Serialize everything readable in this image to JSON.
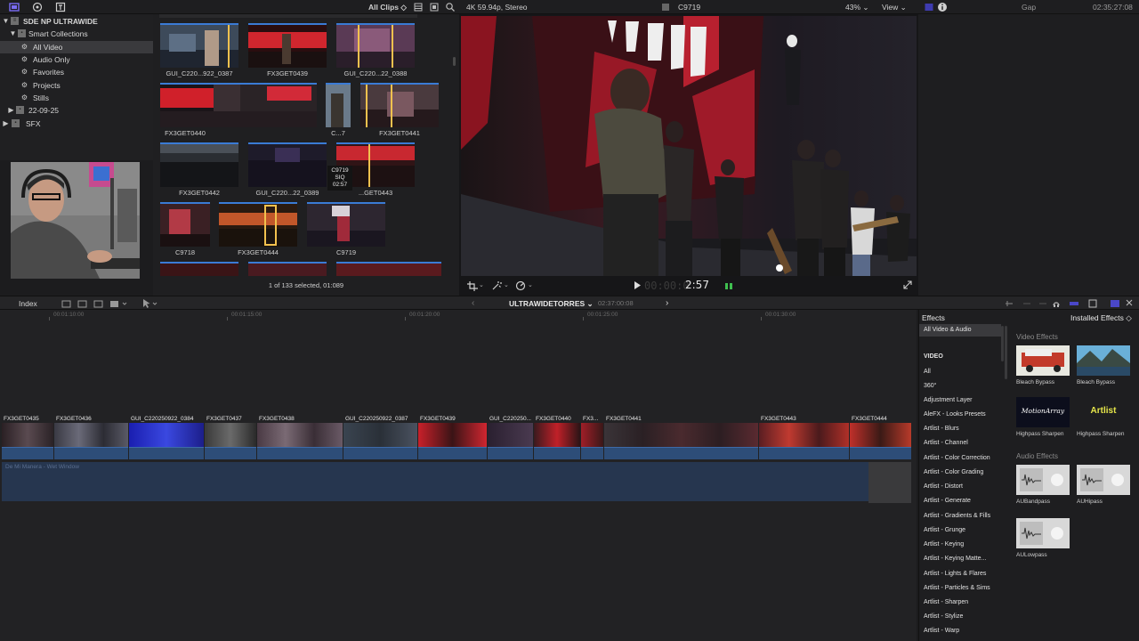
{
  "top_bar": {
    "library_name": "SDE NP ULTRAWIDE",
    "browser_filter": "All Clips",
    "format": "4K 59.94p, Stereo",
    "viewer_clip": "C9719",
    "zoom": "43%",
    "view_menu": "View",
    "gap_label": "Gap",
    "timecode": "02:35:27:08"
  },
  "library": {
    "items": [
      {
        "label": "SDE NP ULTRAWIDE",
        "glyph": "▼"
      },
      {
        "label": "Smart Collections",
        "glyph": "▼"
      },
      {
        "label": "All Video",
        "glyph": "⚙"
      },
      {
        "label": "Audio Only",
        "glyph": "⚙"
      },
      {
        "label": "Favorites",
        "glyph": "⚙"
      },
      {
        "label": "Projects",
        "glyph": "⚙"
      },
      {
        "label": "Stills",
        "glyph": "⚙"
      },
      {
        "label": "22-09-25",
        "glyph": "▶"
      },
      {
        "label": "SFX",
        "glyph": "▶"
      }
    ]
  },
  "browser": {
    "clips": [
      {
        "name": "GUI_C220...922_0387"
      },
      {
        "name": "FX3GET0439"
      },
      {
        "name": "GUI_C220...22_0388"
      },
      {
        "name": "FX3GET0440"
      },
      {
        "name": "C...7"
      },
      {
        "name": "FX3GET0441"
      },
      {
        "name": "FX3GET0442"
      },
      {
        "name": "GUI_C220...22_0389"
      },
      {
        "name": "...GET0443"
      },
      {
        "name": "C9718"
      },
      {
        "name": "FX3GET0444"
      },
      {
        "name": "C9719"
      }
    ],
    "skim_tooltip": {
      "line1": "C9719",
      "line2": "SIQ",
      "line3": "02:57"
    },
    "status": "1 of 133 selected, 01:089"
  },
  "viewer": {
    "timecode": "2:57"
  },
  "timeline_toolbar": {
    "index_label": "Index",
    "project_name": "ULTRAWIDETORRES",
    "project_duration": "02:37:00:08"
  },
  "timeline": {
    "ruler": [
      "00:01:10:00",
      "00:01:15:00",
      "00:01:20:00",
      "00:01:25:00",
      "00:01:30:00"
    ],
    "clips": [
      {
        "name": "FX3GET0435"
      },
      {
        "name": "FX3GET0436"
      },
      {
        "name": "GUI_C220250922_0384"
      },
      {
        "name": "FX3GET0437"
      },
      {
        "name": "FX3GET0438"
      },
      {
        "name": "GUI_C220250922_0387"
      },
      {
        "name": "FX3GET0439"
      },
      {
        "name": "GUI_C220250..."
      },
      {
        "name": "FX3GET0440"
      },
      {
        "name": "FX3..."
      },
      {
        "name": "FX3GET0441"
      },
      {
        "name": "FX3GET0443"
      },
      {
        "name": "FX3GET0444"
      }
    ],
    "audio_lane_label": "De Mi Manera - Wet Window"
  },
  "effects": {
    "title": "Effects",
    "installed_label": "Installed Effects",
    "categories": [
      "All Video & Audio",
      "VIDEO",
      "All",
      "360°",
      "Adjustment Layer",
      "AleFX - Looks Presets",
      "Artlist - Blurs",
      "Artlist - Channel",
      "Artlist - Color Correction",
      "Artlist - Color Grading",
      "Artlist - Distort",
      "Artlist - Generate",
      "Artlist - Gradients & Fills",
      "Artlist - Grunge",
      "Artlist - Keying",
      "Artlist - Keying Matte...",
      "Artlist - Lights & Flares",
      "Artlist - Particles & Sims",
      "Artlist - Sharpen",
      "Artlist - Stylize",
      "Artlist - Warp"
    ],
    "video_section": "Video Effects",
    "audio_section": "Audio Effects",
    "video_items": [
      {
        "name": "Bleach Bypass",
        "thumb_text": ""
      },
      {
        "name": "Bleach Bypass",
        "thumb_text": ""
      },
      {
        "name": "Highpass Sharpen",
        "thumb_text": "MotionArray"
      },
      {
        "name": "Highpass Sharpen",
        "thumb_text": "Artlist"
      }
    ],
    "audio_items": [
      {
        "name": "AUBandpass"
      },
      {
        "name": "AUHipass"
      },
      {
        "name": "AULowpass"
      }
    ]
  },
  "colors": {
    "accent": "#3a7bd5",
    "selection": "#3a3a3d",
    "clip_audio": "#2d4d78",
    "playhead": "#f2c14e"
  }
}
